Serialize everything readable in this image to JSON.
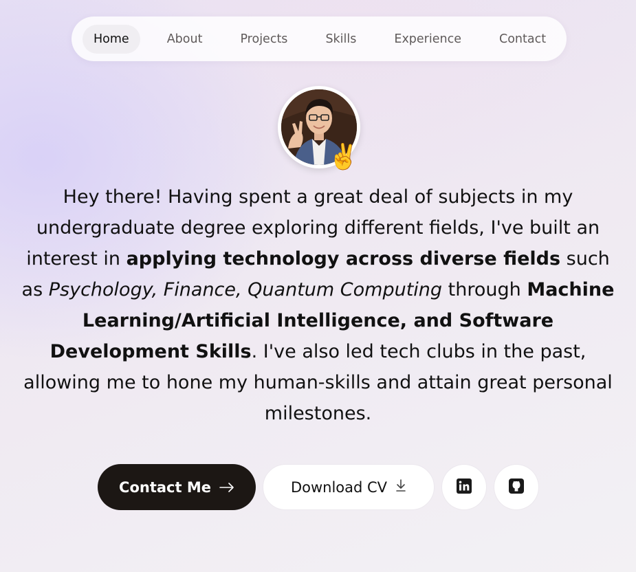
{
  "nav": {
    "items": [
      {
        "label": "Home",
        "active": true
      },
      {
        "label": "About",
        "active": false
      },
      {
        "label": "Projects",
        "active": false
      },
      {
        "label": "Skills",
        "active": false
      },
      {
        "label": "Experience",
        "active": false
      },
      {
        "label": "Contact",
        "active": false
      }
    ]
  },
  "avatar": {
    "icon": "profile-photo",
    "badge_emoji": "✌️"
  },
  "intro": {
    "p1": "Hey there! Having spent a great deal of subjects in my undergraduate degree exploring different fields, I've built an interest in ",
    "b1": "applying technology across diverse fields",
    "p2": " such as ",
    "i1": "Psychology, Finance, Quantum Computing",
    "p3": " through ",
    "b2": "Machine Learning/Artificial Intelligence, and Software Development Skills",
    "p4": ". I've also led tech clubs in the past, allowing me to hone my human-skills and attain great personal milestones."
  },
  "actions": {
    "contact_label": "Contact Me",
    "contact_icon": "arrow-right-icon",
    "cv_label": "Download CV",
    "cv_icon": "download-icon",
    "linkedin_icon": "linkedin-icon",
    "github_icon": "github-icon"
  },
  "colors": {
    "primary_button": "#1c1714",
    "accent_bg": "#e8e1f3"
  }
}
